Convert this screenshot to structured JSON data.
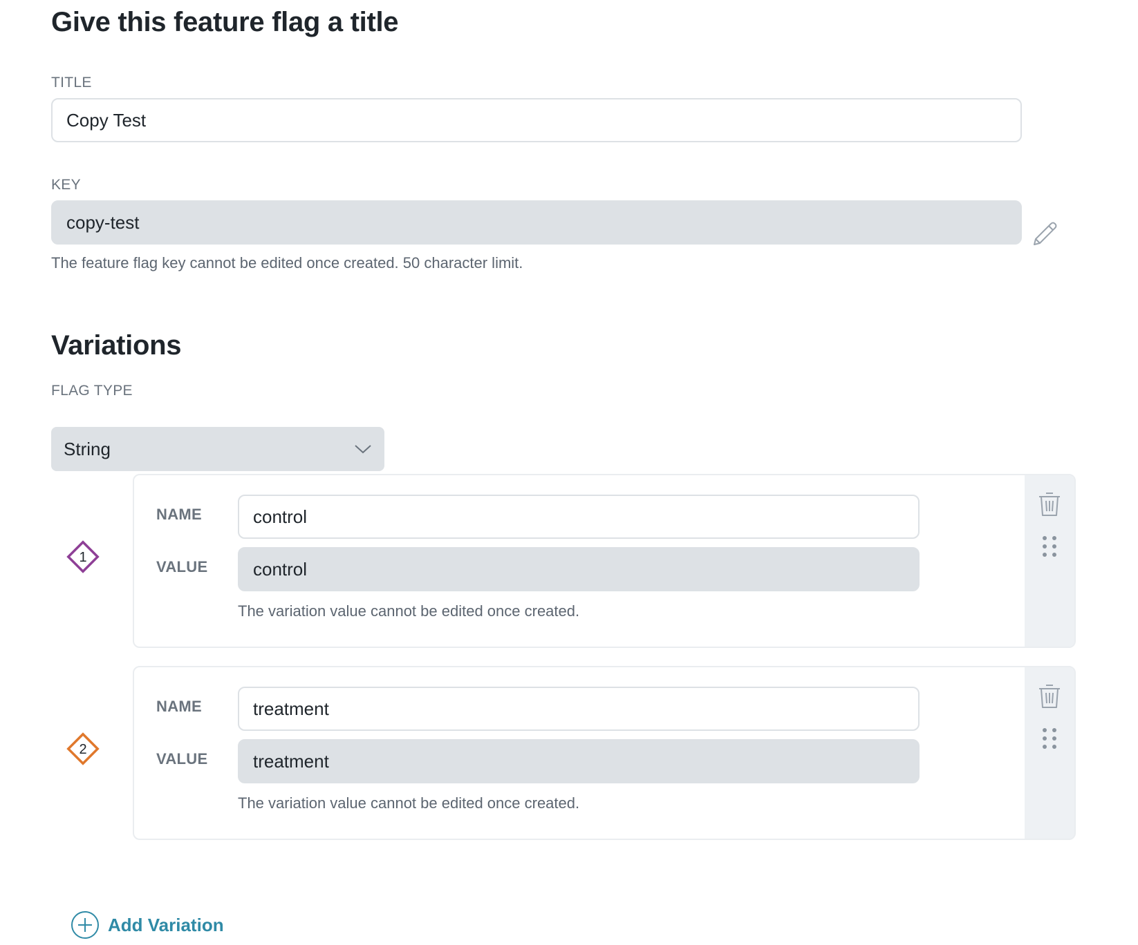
{
  "title_section": {
    "heading": "Give this feature flag a title",
    "title_label": "TITLE",
    "title_value": "Copy Test",
    "key_label": "KEY",
    "key_value": "copy-test",
    "key_help": "The feature flag key cannot be edited once created. 50 character limit."
  },
  "variations_section": {
    "heading": "Variations",
    "flag_type_label": "FLAG TYPE",
    "flag_type_value": "String",
    "variations": [
      {
        "number": "1",
        "marker_color": "#8e3f96",
        "name_label": "NAME",
        "name_value": "control",
        "value_label": "VALUE",
        "value_value": "control",
        "value_help": "The variation value cannot be edited once created."
      },
      {
        "number": "2",
        "marker_color": "#e0782c",
        "name_label": "NAME",
        "name_value": "treatment",
        "value_label": "VALUE",
        "value_value": "treatment",
        "value_help": "The variation value cannot be edited once created."
      }
    ],
    "add_variation_label": "Add Variation"
  },
  "icons": {
    "edit": "pencil-icon",
    "dropdown": "chevron-down-icon",
    "delete": "trash-icon",
    "drag": "drag-handle-icon",
    "add": "plus-circle-icon",
    "variation_marker": "diamond-icon"
  },
  "colors": {
    "accent": "#2f8aa6",
    "readonly_field": "#dde1e5",
    "heading": "#1f252b"
  }
}
